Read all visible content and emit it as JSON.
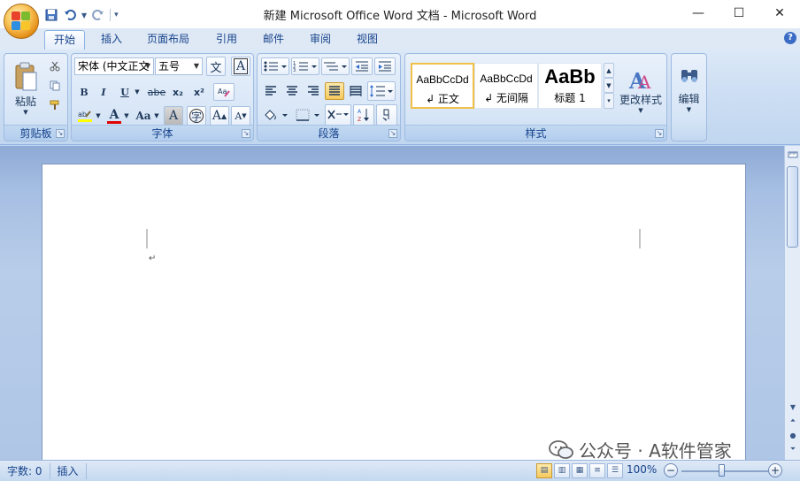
{
  "title": "新建 Microsoft Office Word 文档 - Microsoft Word",
  "quick_access": {
    "save_icon": "save-icon",
    "undo_icon": "undo-icon",
    "redo_icon": "redo-icon",
    "customize_icon": "customize-qat-icon"
  },
  "window_controls": {
    "minimize": "—",
    "maximize": "☐",
    "close": "✕"
  },
  "tabs": [
    {
      "label": "开始",
      "active": true
    },
    {
      "label": "插入"
    },
    {
      "label": "页面布局"
    },
    {
      "label": "引用"
    },
    {
      "label": "邮件"
    },
    {
      "label": "审阅"
    },
    {
      "label": "视图"
    }
  ],
  "help_label": "?",
  "ribbon": {
    "clipboard": {
      "label": "剪贴板",
      "paste_label": "粘贴"
    },
    "font": {
      "label": "字体",
      "font_name": "宋体 (中文正文",
      "font_size": "五号",
      "bold": "B",
      "italic": "I",
      "underline": "U",
      "strike": "abe",
      "subscript": "x₂",
      "superscript": "x²",
      "font_color_letter": "A",
      "change_case": "Aa",
      "grow": "A",
      "shrink": "A",
      "char_border": "A",
      "wen": "文",
      "yin": "字"
    },
    "paragraph": {
      "label": "段落"
    },
    "styles": {
      "label": "样式",
      "items": [
        {
          "sample": "AaBbCcDd",
          "name": "↲ 正文"
        },
        {
          "sample": "AaBbCcDd",
          "name": "↲ 无间隔"
        },
        {
          "sample": "AaBb",
          "name": "标题 1"
        }
      ],
      "change_styles": "更改样式"
    },
    "editing": {
      "label": "编辑"
    }
  },
  "document": {
    "paragraph_mark": "↵"
  },
  "watermark": "公众号 · A软件管家",
  "status": {
    "word_count": "字数: 0",
    "mode": "插入",
    "zoom": "100%"
  }
}
